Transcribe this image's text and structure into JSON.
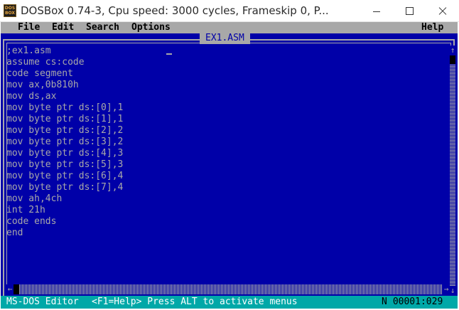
{
  "window": {
    "icon_line1": "DOS",
    "icon_line2": "BOX",
    "title": "DOSBox 0.74-3, Cpu speed:     3000 cycles, Frameskip  0, P..."
  },
  "menu": {
    "file": "File",
    "edit": "Edit",
    "search": "Search",
    "options": "Options",
    "help": "Help"
  },
  "editor": {
    "filename": "EX1.ASM",
    "lines": [
      ";ex1.asm",
      "assume cs:code",
      "code segment",
      "mov ax,0b810h",
      "mov ds,ax",
      "mov byte ptr ds:[0],1",
      "mov byte ptr ds:[1],1",
      "mov byte ptr ds:[2],2",
      "mov byte ptr ds:[3],2",
      "mov byte ptr ds:[4],3",
      "mov byte ptr ds:[5],3",
      "mov byte ptr ds:[6],4",
      "mov byte ptr ds:[7],4",
      "mov ah,4ch",
      "int 21h",
      "code ends",
      "end"
    ]
  },
  "scrollbars": {
    "up_arrow": "↑",
    "down_arrow": "↓",
    "left_arrow": "←",
    "right_arrow": "→"
  },
  "status": {
    "app_name": "MS-DOS Editor",
    "hint": "<F1=Help> Press ALT to activate menus",
    "mode": "N",
    "position": "00001:029"
  },
  "colors": {
    "dos_blue": "#0000a8",
    "dos_gray": "#a8a8a8",
    "status_cyan": "#00a8a8"
  }
}
